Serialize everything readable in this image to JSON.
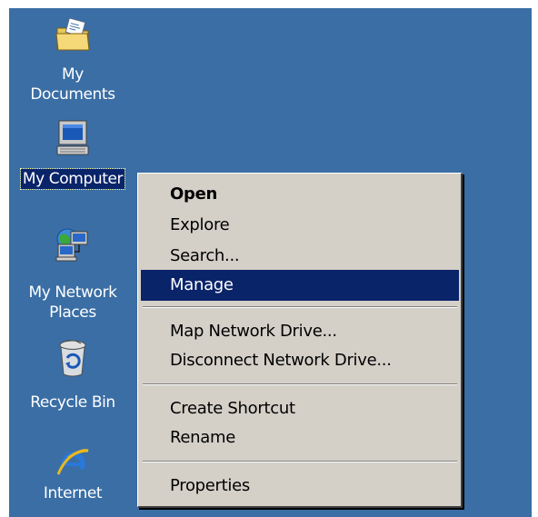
{
  "desktop": {
    "background_color": "#3a6ea5",
    "icons": [
      {
        "name": "My Documents",
        "line1": "My",
        "line2": "Documents",
        "icon": "folder-documents-icon"
      },
      {
        "name": "My Computer",
        "label": "My Computer",
        "icon": "computer-icon",
        "selected": true
      },
      {
        "name": "My Network Places",
        "line1": "My Network",
        "line2": "Places",
        "icon": "network-places-icon"
      },
      {
        "name": "Recycle Bin",
        "label": "Recycle Bin",
        "icon": "recycle-bin-icon"
      },
      {
        "name": "Internet",
        "label": "Internet",
        "icon": "internet-explorer-icon"
      }
    ]
  },
  "context_menu": {
    "items": [
      {
        "label": "Open",
        "bold": true
      },
      {
        "label": "Explore"
      },
      {
        "label": "Search..."
      },
      {
        "label": "Manage",
        "highlighted": true
      },
      {
        "label": "Map Network Drive..."
      },
      {
        "label": "Disconnect Network Drive..."
      },
      {
        "label": "Create Shortcut"
      },
      {
        "label": "Rename"
      },
      {
        "label": "Properties"
      }
    ],
    "highlight_color": "#0a246a",
    "menu_color": "#d4d0c8"
  }
}
